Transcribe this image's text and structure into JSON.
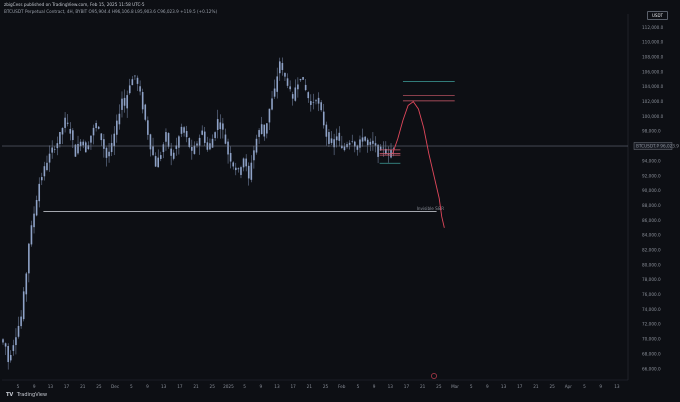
{
  "header": {
    "published_line": "zbigCess published on TradingView.com, Feb 15, 2025 11:58 UTC-5",
    "symbol_line": "BTCUSDT Perpetual Contract, 4H, BYBIT  O95,904.4  H96,106.8  L95,903.6  C96,023.9  +119.5 (+0.12%)",
    "currency": "USDT"
  },
  "footer": {
    "logo": "TV",
    "brand": "TradingView"
  },
  "colors": {
    "background": "#0d0f14",
    "candle": "#8fa3c8",
    "price_line": "#7a8090",
    "teal_line": "#3fa19c",
    "red_line": "#d45c6e",
    "projection": "#e0475b",
    "label_line": "#d7dbe2"
  },
  "chart_data": {
    "type": "candlestick",
    "symbol": "BTCUSDT Perpetual Contract, 4H, BYBIT",
    "y_ticks": [
      112000,
      110000,
      108000,
      106000,
      104000,
      102000,
      100000,
      98000,
      96000,
      94000,
      92000,
      90000,
      88000,
      86000,
      84000,
      82000,
      80000,
      78000,
      76000,
      74000,
      72000,
      70000,
      68000,
      66000
    ],
    "ylim": [
      64500,
      113000
    ],
    "x_ticks": [
      "5",
      "9",
      "13",
      "17",
      "21",
      "25",
      "Dec",
      "5",
      "9",
      "13",
      "17",
      "21",
      "25",
      "2025",
      "5",
      "9",
      "13",
      "17",
      "21",
      "25",
      "Feb",
      "5",
      "9",
      "13",
      "17",
      "21",
      "25",
      "Mar",
      "5",
      "9",
      "13",
      "17",
      "21",
      "25",
      "Apr",
      "5",
      "9",
      "13"
    ],
    "current_price": 96023.9,
    "current_price_label": "BTCUSDT.P  96,023.9",
    "price_path": [
      [
        0,
        70000
      ],
      [
        2,
        69000
      ],
      [
        3,
        67000
      ],
      [
        5,
        69500
      ],
      [
        8,
        73000
      ],
      [
        10,
        79000
      ],
      [
        11,
        83000
      ],
      [
        13,
        87000
      ],
      [
        15,
        91000
      ],
      [
        18,
        94000
      ],
      [
        20,
        95500
      ],
      [
        22,
        96500
      ],
      [
        24,
        98500
      ],
      [
        25,
        99500
      ],
      [
        27,
        98000
      ],
      [
        29,
        95000
      ],
      [
        31,
        97000
      ],
      [
        33,
        95500
      ],
      [
        35,
        97500
      ],
      [
        37,
        99000
      ],
      [
        39,
        97000
      ],
      [
        41,
        94500
      ],
      [
        43,
        96000
      ],
      [
        45,
        99000
      ],
      [
        47,
        102500
      ],
      [
        48,
        101500
      ],
      [
        50,
        104500
      ],
      [
        52,
        105500
      ],
      [
        54,
        103000
      ],
      [
        56,
        99500
      ],
      [
        58,
        96000
      ],
      [
        60,
        93500
      ],
      [
        62,
        95000
      ],
      [
        64,
        97500
      ],
      [
        66,
        94500
      ],
      [
        68,
        96000
      ],
      [
        70,
        98500
      ],
      [
        72,
        97000
      ],
      [
        74,
        95000
      ],
      [
        76,
        96500
      ],
      [
        78,
        98000
      ],
      [
        80,
        95500
      ],
      [
        82,
        97000
      ],
      [
        84,
        99500
      ],
      [
        86,
        98000
      ],
      [
        88,
        95000
      ],
      [
        90,
        93500
      ],
      [
        92,
        92500
      ],
      [
        94,
        94500
      ],
      [
        96,
        91500
      ],
      [
        97,
        94000
      ],
      [
        99,
        97000
      ],
      [
        101,
        99000
      ],
      [
        102,
        97500
      ],
      [
        104,
        101000
      ],
      [
        106,
        103500
      ],
      [
        108,
        107500
      ],
      [
        109,
        106000
      ],
      [
        111,
        104500
      ],
      [
        113,
        102000
      ],
      [
        114,
        104000
      ],
      [
        116,
        105500
      ],
      [
        118,
        103500
      ],
      [
        120,
        101500
      ],
      [
        122,
        102500
      ],
      [
        124,
        100500
      ],
      [
        126,
        97500
      ],
      [
        128,
        96000
      ],
      [
        130,
        97500
      ],
      [
        132,
        95500
      ],
      [
        134,
        96500
      ],
      [
        136,
        97000
      ],
      [
        138,
        95500
      ],
      [
        140,
        97500
      ],
      [
        142,
        96000
      ],
      [
        144,
        96500
      ],
      [
        146,
        95000
      ],
      [
        148,
        96000
      ],
      [
        150,
        94500
      ],
      [
        151,
        95500
      ],
      [
        152,
        96023.9
      ]
    ],
    "candle_count": 152,
    "range_lines": [
      {
        "name": "top-teal",
        "price": 104700,
        "color": "teal",
        "x_start": 155,
        "x_end": 175
      },
      {
        "name": "red-upper",
        "price": 102800,
        "color": "red",
        "x_start": 155,
        "x_end": 175
      },
      {
        "name": "red-lower",
        "price": 102100,
        "color": "red",
        "x_start": 155,
        "x_end": 175
      },
      {
        "name": "short-red-a",
        "price": 95500,
        "color": "red",
        "x_start": 146,
        "x_end": 154
      },
      {
        "name": "short-red-b",
        "price": 95000,
        "color": "red",
        "x_start": 146,
        "x_end": 154
      },
      {
        "name": "short-red-c",
        "price": 94800,
        "color": "red",
        "x_start": 146,
        "x_end": 154
      },
      {
        "name": "short-teal",
        "price": 93700,
        "color": "teal",
        "x_start": 146,
        "x_end": 154
      }
    ],
    "support_line": {
      "price": 87200,
      "label": "Invisible S&R",
      "x_start": 16,
      "x_end": 168
    },
    "projection_path": [
      [
        151,
        95000
      ],
      [
        153,
        97000
      ],
      [
        155,
        99500
      ],
      [
        157,
        101500
      ],
      [
        159,
        102000
      ],
      [
        161,
        101000
      ],
      [
        163,
        98500
      ],
      [
        165,
        95000
      ],
      [
        167,
        92000
      ],
      [
        169,
        89000
      ],
      [
        170,
        86500
      ],
      [
        171,
        85000
      ]
    ],
    "x_total": 242
  }
}
